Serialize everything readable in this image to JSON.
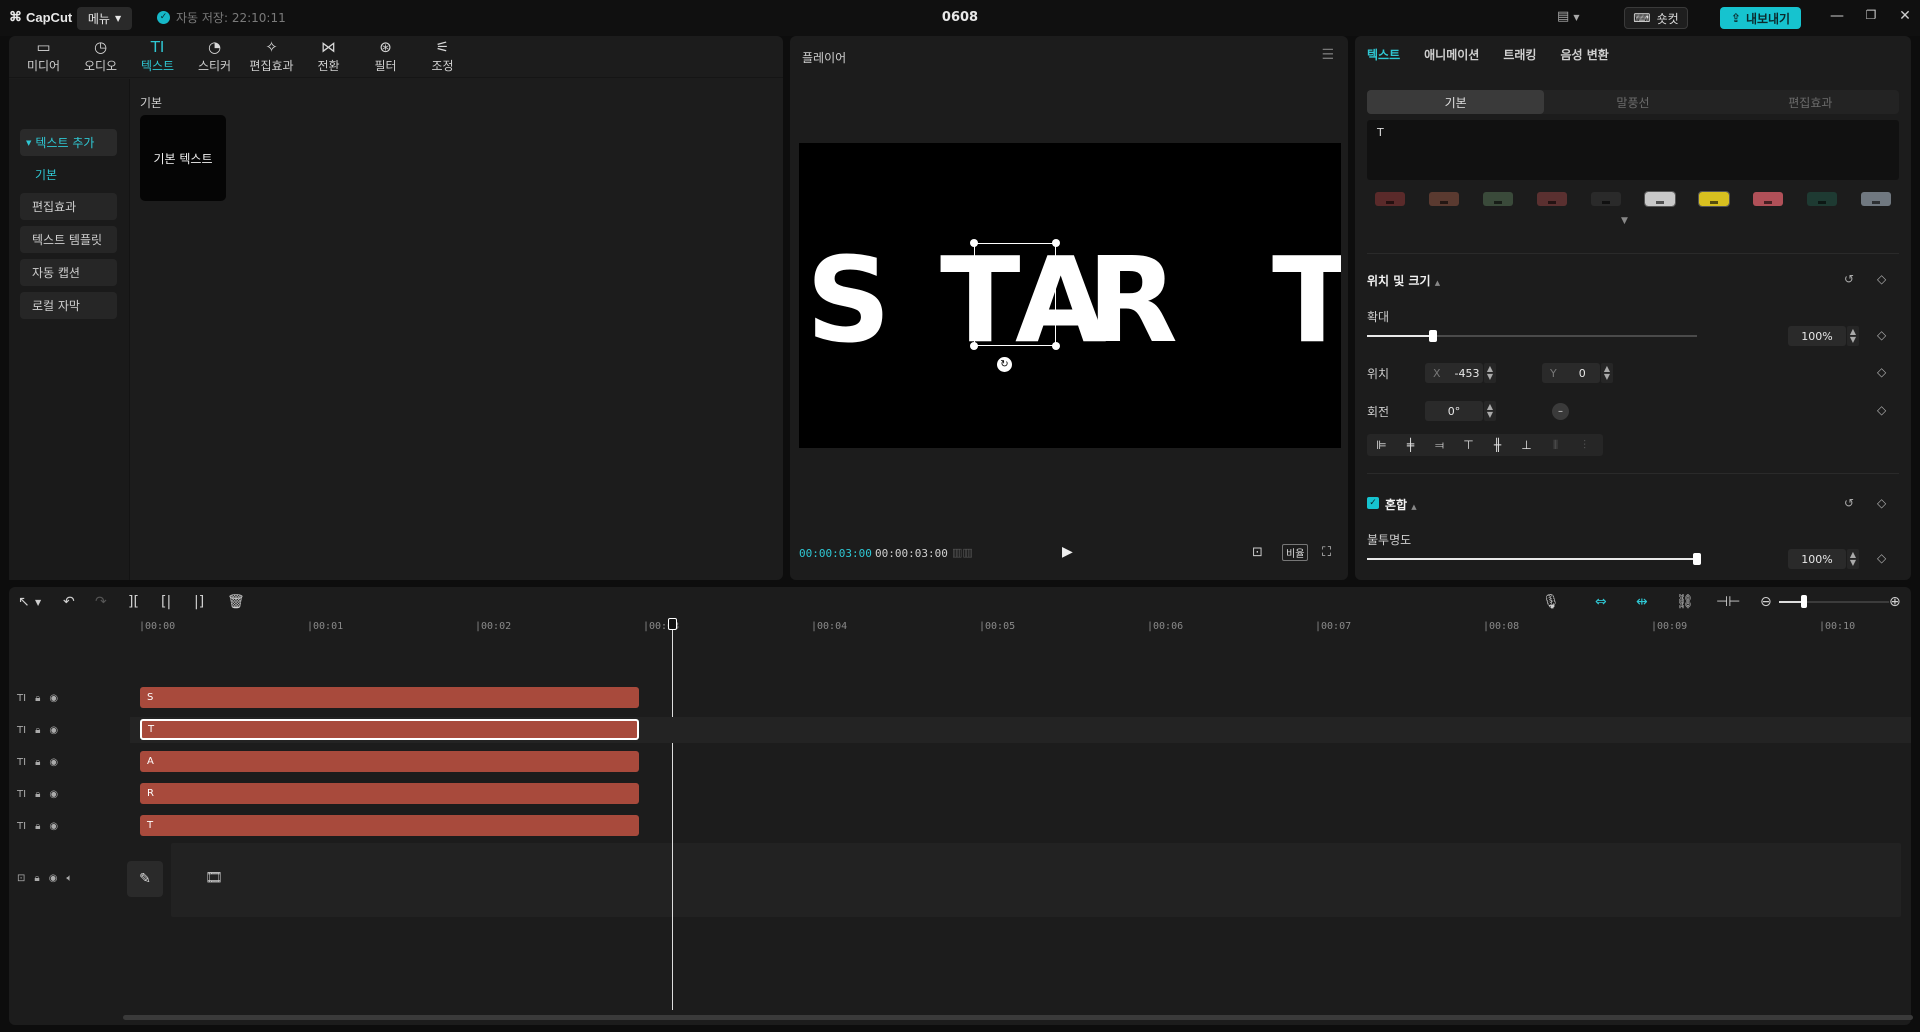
{
  "app": {
    "logo_label": "CapCut",
    "menu_label": "메뉴",
    "autosave": "자동 저장: 22:10:11",
    "project_title": "0608",
    "shortcut_label": "숏컷",
    "export_label": "내보내기"
  },
  "media": {
    "tools": [
      {
        "label": "미디어",
        "icon": "media-icon",
        "glyph": "▭"
      },
      {
        "label": "오디오",
        "icon": "audio-icon",
        "glyph": "◷"
      },
      {
        "label": "텍스트",
        "icon": "text-icon",
        "glyph": "TI"
      },
      {
        "label": "스티커",
        "icon": "sticker-icon",
        "glyph": "◔"
      },
      {
        "label": "편집효과",
        "icon": "effects-icon",
        "glyph": "✧"
      },
      {
        "label": "전환",
        "icon": "transition-icon",
        "glyph": "⋈"
      },
      {
        "label": "필터",
        "icon": "filter-icon",
        "glyph": "⊛"
      },
      {
        "label": "조정",
        "icon": "adjust-icon",
        "glyph": "⚟"
      }
    ],
    "active_tool": "텍스트",
    "sidebar": [
      "텍스트 추가",
      "기본",
      "편집효과",
      "텍스트 템플릿",
      "자동 캡션",
      "로컬 자막"
    ],
    "section_label": "기본",
    "card_label": "기본 텍스트"
  },
  "player": {
    "title": "플레이어",
    "letters": [
      "S",
      "T",
      "A",
      "R",
      "T"
    ],
    "current_time": "00:00:03:00",
    "total_time": "00:00:03:00",
    "ratio_label": "비율"
  },
  "props": {
    "tabs": [
      "텍스트",
      "애니메이션",
      "트래킹",
      "음성 변환"
    ],
    "segments": [
      "기본",
      "말풍선",
      "편집효과"
    ],
    "text_value": "T",
    "preset_colors": [
      "#5a2a2a",
      "#5a3a30",
      "#3a4a3a",
      "#5a3030",
      "#2a2a2a",
      "#c8c8c8",
      "#d8c020",
      "#b05058",
      "#1e3a32",
      "#707880"
    ],
    "position_section": "위치 및 크기",
    "scale_label": "확대",
    "scale_value": "100%",
    "scale_fraction": 0.2,
    "position_label": "위치",
    "x_label": "X",
    "x_value": "-453",
    "y_label": "Y",
    "y_value": "0",
    "rotation_label": "회전",
    "rotation_value": "0°",
    "blend_section": "혼합",
    "opacity_label": "불투명도",
    "opacity_value": "100%",
    "opacity_fraction": 1.0
  },
  "timeline": {
    "ticks": [
      "00:00",
      "00:01",
      "00:02",
      "00:03",
      "00:04",
      "00:05",
      "00:06",
      "00:07",
      "00:08",
      "00:09",
      "00:10"
    ],
    "clips": [
      "S",
      "T",
      "A",
      "R",
      "T"
    ],
    "selected_clip_index": 1
  }
}
